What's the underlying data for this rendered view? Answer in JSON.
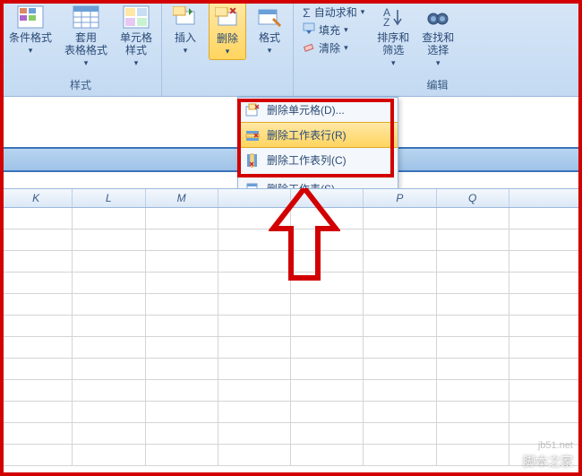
{
  "ribbon": {
    "styles_group": {
      "label": "样式",
      "cond_format": "条件格式",
      "format_table": "套用\n表格格式",
      "cell_styles": "单元格\n样式"
    },
    "cells_group": {
      "insert": "插入",
      "delete": "删除",
      "format": "格式"
    },
    "editing_group": {
      "label": "编辑",
      "autosum": "自动求和",
      "fill": "填充",
      "clear": "清除",
      "sort_filter": "排序和\n筛选",
      "find_select": "查找和\n选择"
    }
  },
  "dropdown": {
    "delete_cells": "删除单元格(D)...",
    "delete_rows": "删除工作表行(R)",
    "delete_cols": "删除工作表列(C)",
    "delete_sheet": "删除工作表(S)"
  },
  "columns": [
    "K",
    "L",
    "M",
    "",
    "",
    "P",
    "Q",
    ""
  ],
  "watermark": "jb51.net",
  "watermark2": "脚本之家"
}
